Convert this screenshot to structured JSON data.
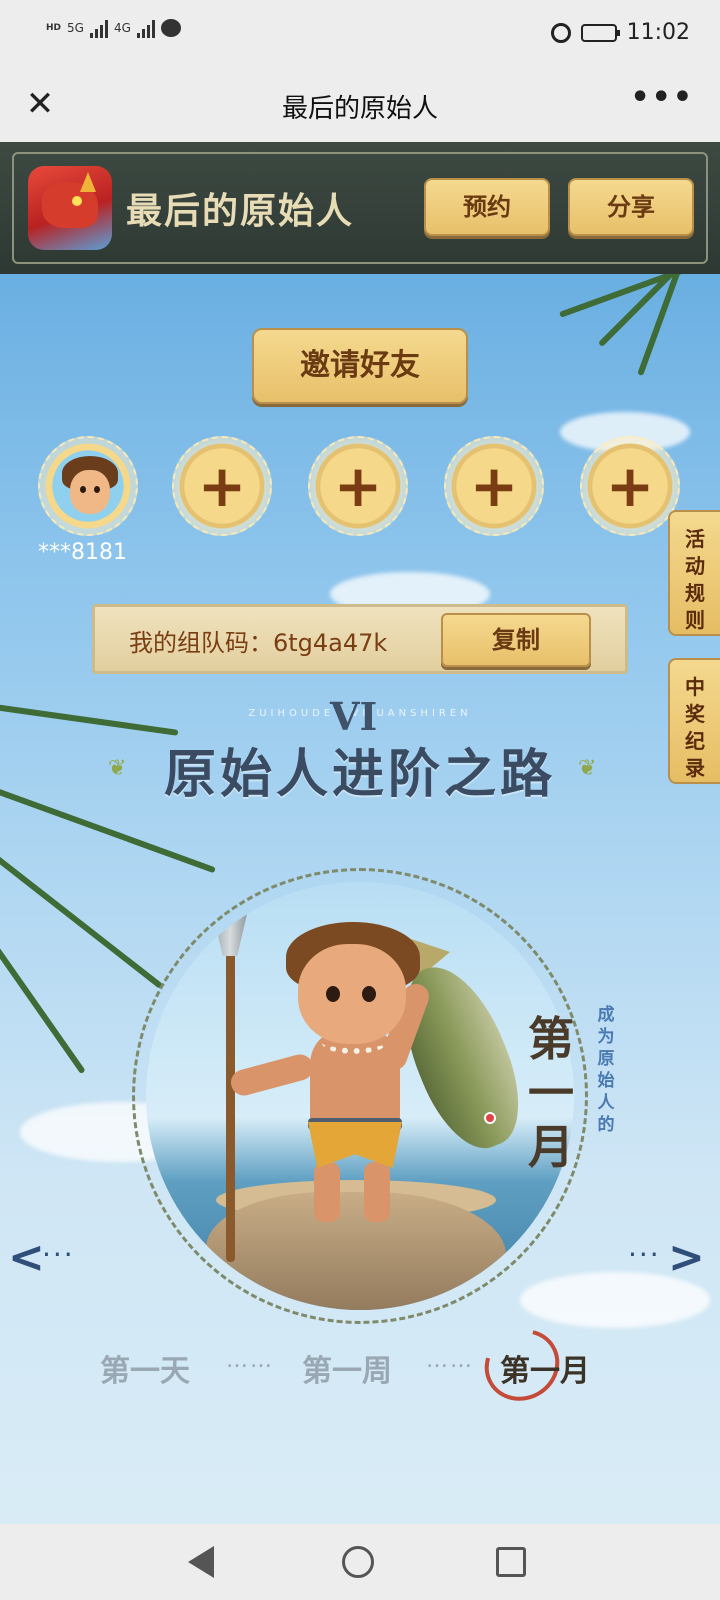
{
  "status_bar": {
    "network_left": "HD",
    "net_5g": "5G",
    "net_4g": "4G",
    "time": "11:02"
  },
  "nav": {
    "title": "最后的原始人",
    "close_label": "✕",
    "more_label": "•••"
  },
  "header": {
    "game_name": "最后的原始人",
    "reserve_label": "预约",
    "share_label": "分享"
  },
  "invite": {
    "button_label": "邀请好友",
    "slots": [
      {
        "type": "avatar",
        "label": "***8181"
      },
      {
        "type": "empty",
        "label": "+"
      },
      {
        "type": "empty",
        "label": "+"
      },
      {
        "type": "empty",
        "label": "+"
      },
      {
        "type": "empty",
        "label": "+"
      }
    ]
  },
  "team": {
    "code_text": "我的组队码：6tg4a47k",
    "copy_label": "复制"
  },
  "side_tabs": {
    "rules": "活动规则",
    "prizes": "中奖纪录"
  },
  "road": {
    "caps": "ZUIHOUDEY VI UANSHIREN",
    "roman": "VI",
    "title": "原始人进阶之路",
    "current_stage_vertical": "第一月",
    "current_stage_sub": "成为原始人的",
    "stages": [
      {
        "label": "第一天",
        "active": false
      },
      {
        "label": "第一周",
        "active": false
      },
      {
        "label": "第一月",
        "active": true
      }
    ],
    "dots": "……",
    "arrow_left": "<",
    "arrow_right": ">",
    "arrow_dots": "···"
  },
  "colors": {
    "button_fill": "#f5d98f",
    "button_text": "#6a3a12",
    "title_text": "#3b4c62",
    "sky_top": "#5aa5dd"
  }
}
